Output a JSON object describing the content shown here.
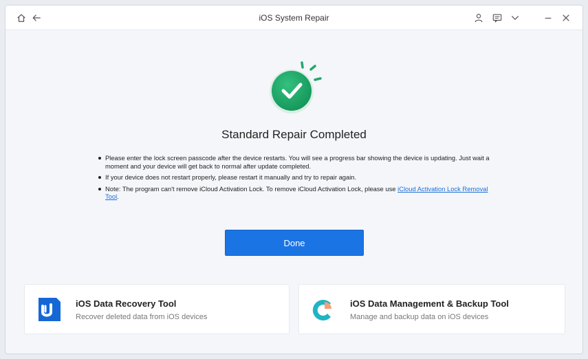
{
  "window": {
    "title": "iOS System Repair"
  },
  "titlebar_icons": [
    "home-icon",
    "back-arrow-icon",
    "user-icon",
    "feedback-icon",
    "chevron-down-icon",
    "minimize-icon",
    "close-icon"
  ],
  "main": {
    "heading": "Standard Repair Completed",
    "notes": [
      "Please enter the lock screen passcode after the device restarts. You will see a progress bar showing the device is updating. Just wait a moment and your device will get back to normal after update completed.",
      "If your device does not restart properly, please restart it manually and try to repair again."
    ],
    "note3_prefix": "Note: The program can't remove iCloud Activation Lock. To remove iCloud Activation Lock, please use ",
    "note3_link": "iCloud Activation Lock Removal Tool",
    "note3_suffix": ".",
    "done_label": "Done"
  },
  "cards": [
    {
      "title": "iOS Data Recovery Tool",
      "desc": "Recover deleted data from iOS devices"
    },
    {
      "title": "iOS Data Management & Backup Tool",
      "desc": "Manage and backup data on iOS devices"
    }
  ],
  "colors": {
    "accent": "#1b74e4",
    "success": "#1fa36b",
    "link": "#1a6fd6"
  }
}
